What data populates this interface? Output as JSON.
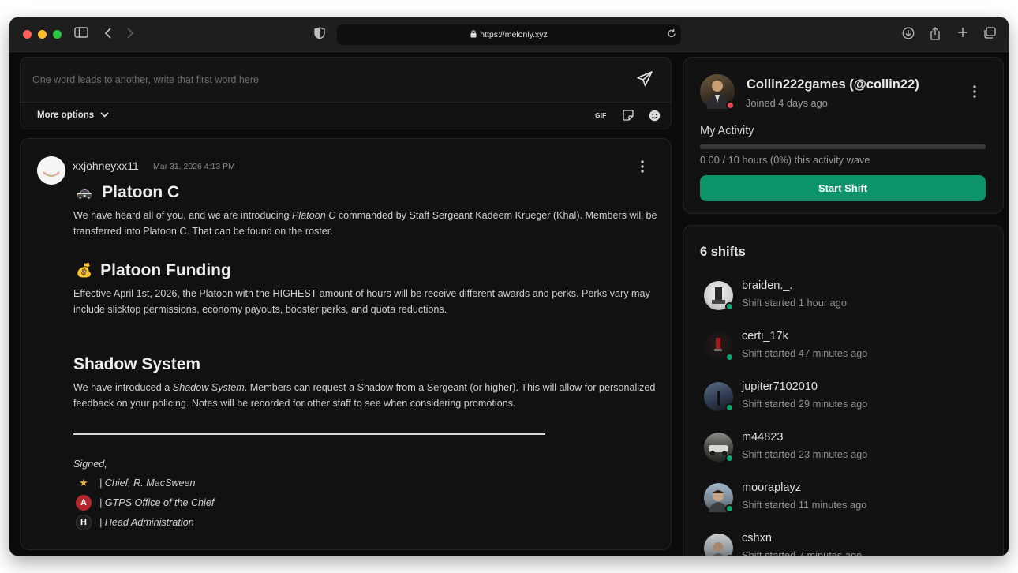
{
  "browser": {
    "url": "https://melonly.xyz",
    "traffic_colors": [
      "#ff5f57",
      "#febc2e",
      "#28c840"
    ]
  },
  "composer": {
    "placeholder": "One word leads to another, write that first word here",
    "more_options": "More options",
    "gif_label": "GIF"
  },
  "post": {
    "username": "xxjohneyxx11",
    "timestamp": "Mar 31, 2026 4:13 PM",
    "sections": [
      {
        "emoji": "🚓",
        "title": "Platoon C",
        "body_before": "We have heard all of you, and we are introducing ",
        "body_italic": "Platoon C",
        "body_after": " commanded by Staff Sergeant Kadeem Krueger (Khal). Members will be transferred into Platoon C. That can be found on the roster."
      },
      {
        "emoji": "💰",
        "title": "Platoon Funding",
        "body": "Effective April 1st, 2026, the Platoon with the HIGHEST amount of hours will be receive different awards and perks. Perks vary may include slicktop permissions, economy payouts, booster perks, and quota reductions."
      },
      {
        "title": "Shadow System",
        "body_before": "We have introduced a ",
        "body_italic": "Shadow System",
        "body_after": ". Members can request a Shadow from a Sergeant (or higher). This will allow for personalized feedback on your policing. Notes will be recorded for other staff to see when considering promotions."
      }
    ],
    "signed": "Signed,",
    "signatures": [
      {
        "badge": "★",
        "text": "| Chief, R. MacSween"
      },
      {
        "badge": "A",
        "text": "| GTPS Office of the Chief"
      },
      {
        "badge": "H",
        "text": "| Head Administration"
      }
    ]
  },
  "profile": {
    "name": "Collin222games (@collin22)",
    "joined": "Joined 4 days ago",
    "activity_label": "My Activity",
    "activity_fraction": 0.0,
    "hours_text": "0.00 / 10 hours (0%) this activity wave",
    "start_button": "Start Shift",
    "status_color": "#e5484d"
  },
  "shifts": {
    "title": "6 shifts",
    "online_color": "#12a66f",
    "items": [
      {
        "name": "braiden._.",
        "sub": "Shift started 1 hour ago"
      },
      {
        "name": "certi_17k",
        "sub": "Shift started 47 minutes ago"
      },
      {
        "name": "jupiter7102010",
        "sub": "Shift started 29 minutes ago"
      },
      {
        "name": "m44823",
        "sub": "Shift started 23 minutes ago"
      },
      {
        "name": "mooraplayz",
        "sub": "Shift started 11 minutes ago"
      },
      {
        "name": "cshxn",
        "sub": "Shift started 7 minutes ago"
      }
    ]
  },
  "colors": {
    "accent_green": "#0b946a"
  }
}
